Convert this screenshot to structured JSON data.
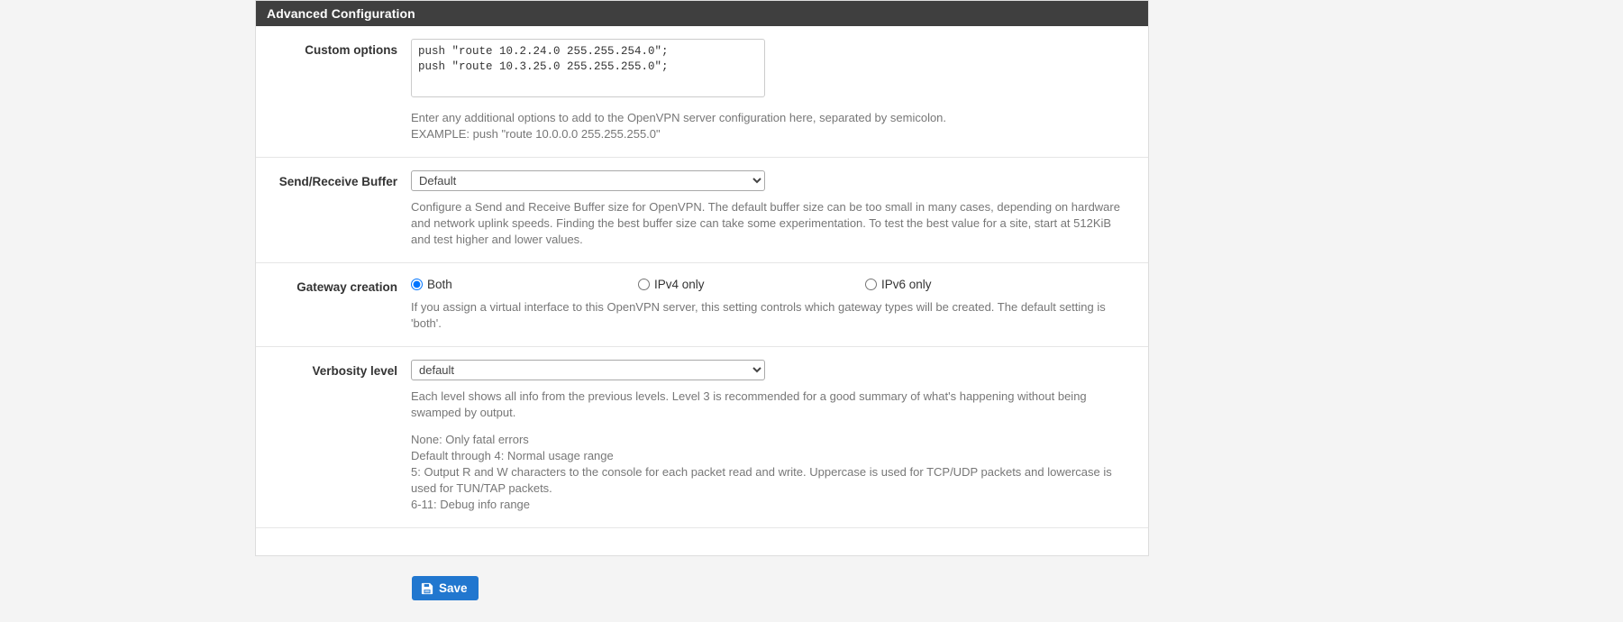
{
  "panel": {
    "title": "Advanced Configuration"
  },
  "fields": {
    "custom_options": {
      "label": "Custom options",
      "value": "push \"route 10.2.24.0 255.255.254.0\";\npush \"route 10.3.25.0 255.255.255.0\";",
      "placeholder": "",
      "help_line1": "Enter any additional options to add to the OpenVPN server configuration here, separated by semicolon.",
      "help_line2": "EXAMPLE: push \"route 10.0.0.0 255.255.255.0\""
    },
    "send_receive_buffer": {
      "label": "Send/Receive Buffer",
      "value": "Default",
      "options": [
        "Default"
      ],
      "help": "Configure a Send and Receive Buffer size for OpenVPN. The default buffer size can be too small in many cases, depending on hardware and network uplink speeds. Finding the best buffer size can take some experimentation. To test the best value for a site, start at 512KiB and test higher and lower values."
    },
    "gateway_creation": {
      "label": "Gateway creation",
      "selected": "Both",
      "options": [
        {
          "label": "Both",
          "checked": true
        },
        {
          "label": "IPv4 only",
          "checked": false
        },
        {
          "label": "IPv6 only",
          "checked": false
        }
      ],
      "help": "If you assign a virtual interface to this OpenVPN server, this setting controls which gateway types will be created. The default setting is 'both'."
    },
    "verbosity_level": {
      "label": "Verbosity level",
      "value": "default",
      "options": [
        "default"
      ],
      "help_intro": "Each level shows all info from the previous levels. Level 3 is recommended for a good summary of what's happening without being swamped by output.",
      "help_lines": [
        "None: Only fatal errors",
        "Default through 4: Normal usage range",
        "5: Output R and W characters to the console for each packet read and write. Uppercase is used for TCP/UDP packets and lowercase is used for TUN/TAP packets.",
        "6-11: Debug info range"
      ]
    }
  },
  "actions": {
    "save_label": "Save",
    "save_icon": "floppy-disk-icon",
    "save_color": "#2177cf"
  }
}
